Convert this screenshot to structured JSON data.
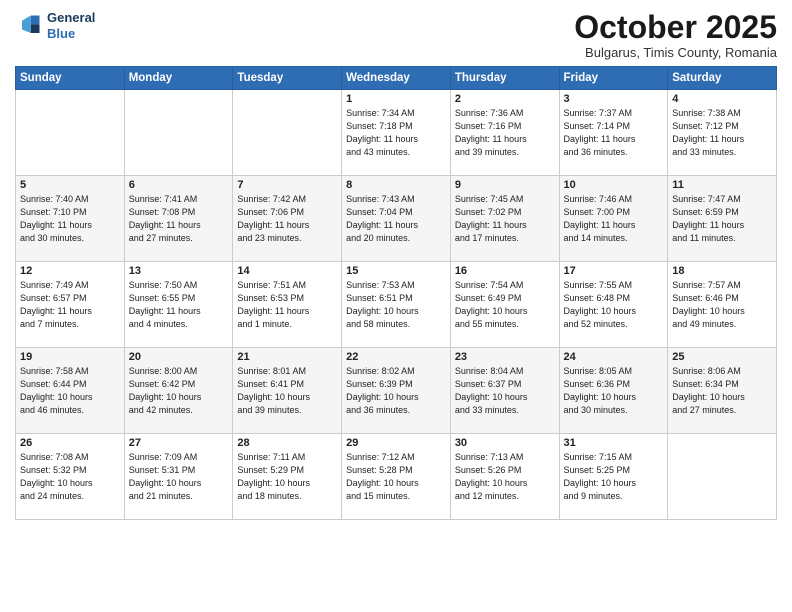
{
  "header": {
    "logo_line1": "General",
    "logo_line2": "Blue",
    "month": "October 2025",
    "location": "Bulgarus, Timis County, Romania"
  },
  "weekdays": [
    "Sunday",
    "Monday",
    "Tuesday",
    "Wednesday",
    "Thursday",
    "Friday",
    "Saturday"
  ],
  "weeks": [
    [
      {
        "day": "",
        "info": ""
      },
      {
        "day": "",
        "info": ""
      },
      {
        "day": "",
        "info": ""
      },
      {
        "day": "1",
        "info": "Sunrise: 7:34 AM\nSunset: 7:18 PM\nDaylight: 11 hours\nand 43 minutes."
      },
      {
        "day": "2",
        "info": "Sunrise: 7:36 AM\nSunset: 7:16 PM\nDaylight: 11 hours\nand 39 minutes."
      },
      {
        "day": "3",
        "info": "Sunrise: 7:37 AM\nSunset: 7:14 PM\nDaylight: 11 hours\nand 36 minutes."
      },
      {
        "day": "4",
        "info": "Sunrise: 7:38 AM\nSunset: 7:12 PM\nDaylight: 11 hours\nand 33 minutes."
      }
    ],
    [
      {
        "day": "5",
        "info": "Sunrise: 7:40 AM\nSunset: 7:10 PM\nDaylight: 11 hours\nand 30 minutes."
      },
      {
        "day": "6",
        "info": "Sunrise: 7:41 AM\nSunset: 7:08 PM\nDaylight: 11 hours\nand 27 minutes."
      },
      {
        "day": "7",
        "info": "Sunrise: 7:42 AM\nSunset: 7:06 PM\nDaylight: 11 hours\nand 23 minutes."
      },
      {
        "day": "8",
        "info": "Sunrise: 7:43 AM\nSunset: 7:04 PM\nDaylight: 11 hours\nand 20 minutes."
      },
      {
        "day": "9",
        "info": "Sunrise: 7:45 AM\nSunset: 7:02 PM\nDaylight: 11 hours\nand 17 minutes."
      },
      {
        "day": "10",
        "info": "Sunrise: 7:46 AM\nSunset: 7:00 PM\nDaylight: 11 hours\nand 14 minutes."
      },
      {
        "day": "11",
        "info": "Sunrise: 7:47 AM\nSunset: 6:59 PM\nDaylight: 11 hours\nand 11 minutes."
      }
    ],
    [
      {
        "day": "12",
        "info": "Sunrise: 7:49 AM\nSunset: 6:57 PM\nDaylight: 11 hours\nand 7 minutes."
      },
      {
        "day": "13",
        "info": "Sunrise: 7:50 AM\nSunset: 6:55 PM\nDaylight: 11 hours\nand 4 minutes."
      },
      {
        "day": "14",
        "info": "Sunrise: 7:51 AM\nSunset: 6:53 PM\nDaylight: 11 hours\nand 1 minute."
      },
      {
        "day": "15",
        "info": "Sunrise: 7:53 AM\nSunset: 6:51 PM\nDaylight: 10 hours\nand 58 minutes."
      },
      {
        "day": "16",
        "info": "Sunrise: 7:54 AM\nSunset: 6:49 PM\nDaylight: 10 hours\nand 55 minutes."
      },
      {
        "day": "17",
        "info": "Sunrise: 7:55 AM\nSunset: 6:48 PM\nDaylight: 10 hours\nand 52 minutes."
      },
      {
        "day": "18",
        "info": "Sunrise: 7:57 AM\nSunset: 6:46 PM\nDaylight: 10 hours\nand 49 minutes."
      }
    ],
    [
      {
        "day": "19",
        "info": "Sunrise: 7:58 AM\nSunset: 6:44 PM\nDaylight: 10 hours\nand 46 minutes."
      },
      {
        "day": "20",
        "info": "Sunrise: 8:00 AM\nSunset: 6:42 PM\nDaylight: 10 hours\nand 42 minutes."
      },
      {
        "day": "21",
        "info": "Sunrise: 8:01 AM\nSunset: 6:41 PM\nDaylight: 10 hours\nand 39 minutes."
      },
      {
        "day": "22",
        "info": "Sunrise: 8:02 AM\nSunset: 6:39 PM\nDaylight: 10 hours\nand 36 minutes."
      },
      {
        "day": "23",
        "info": "Sunrise: 8:04 AM\nSunset: 6:37 PM\nDaylight: 10 hours\nand 33 minutes."
      },
      {
        "day": "24",
        "info": "Sunrise: 8:05 AM\nSunset: 6:36 PM\nDaylight: 10 hours\nand 30 minutes."
      },
      {
        "day": "25",
        "info": "Sunrise: 8:06 AM\nSunset: 6:34 PM\nDaylight: 10 hours\nand 27 minutes."
      }
    ],
    [
      {
        "day": "26",
        "info": "Sunrise: 7:08 AM\nSunset: 5:32 PM\nDaylight: 10 hours\nand 24 minutes."
      },
      {
        "day": "27",
        "info": "Sunrise: 7:09 AM\nSunset: 5:31 PM\nDaylight: 10 hours\nand 21 minutes."
      },
      {
        "day": "28",
        "info": "Sunrise: 7:11 AM\nSunset: 5:29 PM\nDaylight: 10 hours\nand 18 minutes."
      },
      {
        "day": "29",
        "info": "Sunrise: 7:12 AM\nSunset: 5:28 PM\nDaylight: 10 hours\nand 15 minutes."
      },
      {
        "day": "30",
        "info": "Sunrise: 7:13 AM\nSunset: 5:26 PM\nDaylight: 10 hours\nand 12 minutes."
      },
      {
        "day": "31",
        "info": "Sunrise: 7:15 AM\nSunset: 5:25 PM\nDaylight: 10 hours\nand 9 minutes."
      },
      {
        "day": "",
        "info": ""
      }
    ]
  ]
}
